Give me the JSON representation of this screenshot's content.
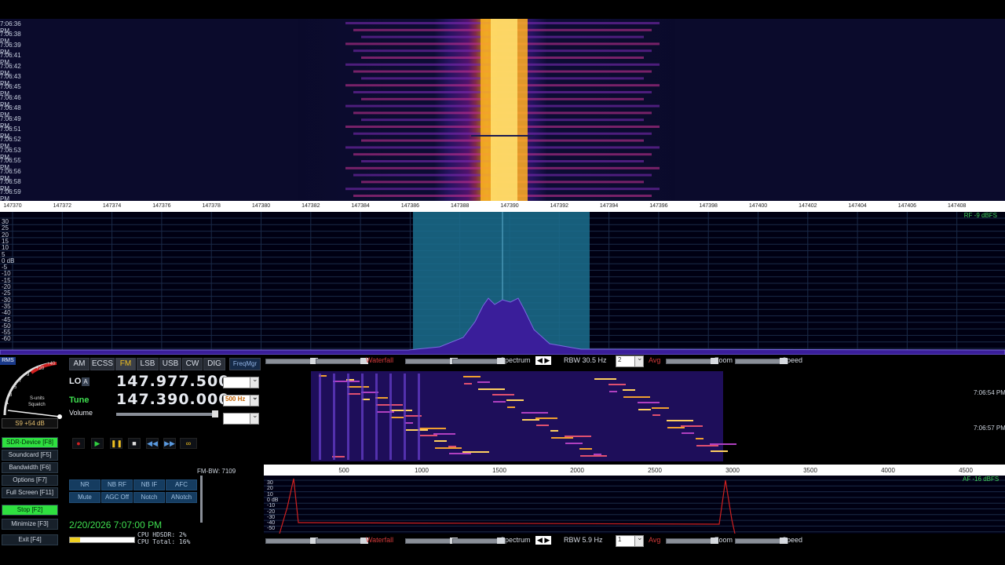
{
  "waterfall_top": {
    "time_labels": [
      "7:06:36 PM",
      "7:06:38 PM",
      "7:06:39 PM",
      "7:06:41 PM",
      "7:06:42 PM",
      "7:06:43 PM",
      "7:06:45 PM",
      "7:06:46 PM",
      "7:06:48 PM",
      "7:06:49 PM",
      "7:06:51 PM",
      "7:06:52 PM",
      "7:06:53 PM",
      "7:06:55 PM",
      "7:06:56 PM",
      "7:06:58 PM",
      "7:06:59 PM"
    ]
  },
  "freq_ruler": {
    "labels": [
      "147370",
      "147372",
      "147374",
      "147376",
      "147378",
      "147380",
      "147382",
      "147384",
      "147386",
      "147388",
      "147390",
      "147392",
      "147394",
      "147396",
      "147398",
      "147400",
      "147402",
      "147404",
      "147406",
      "147408"
    ]
  },
  "spectrum": {
    "db_labels": [
      "30",
      "25",
      "20",
      "15",
      "10",
      "5",
      "0 dB",
      "-5",
      "-10",
      "-15",
      "-20",
      "-25",
      "-30",
      "-35",
      "-40",
      "-45",
      "-50",
      "-55",
      "-60"
    ],
    "rf_level": "RF -9 dBFS"
  },
  "rf_toolbar": {
    "waterfall": "Waterfall",
    "spectrum": "Spectrum",
    "rbw": "RBW 30.5 Hz",
    "avg_value": "2",
    "avg": "Avg",
    "zoom": "Zoom",
    "speed": "Speed"
  },
  "smeter": {
    "rms": "RMS",
    "scale": [
      "+40",
      "+20",
      "9",
      "7",
      "5",
      "3",
      "1"
    ],
    "units": "S-units",
    "squelch": "Squelch",
    "reading": "S9 +54 dB"
  },
  "modes": [
    "AM",
    "ECSS",
    "FM",
    "LSB",
    "USB",
    "CW",
    "DIG"
  ],
  "freqmgr": "FreqMgr",
  "lo": {
    "label": "LO",
    "badge": "A",
    "value": "147.977.500"
  },
  "tune": {
    "label": "Tune",
    "value": "147.390.000",
    "step": "500 Hz"
  },
  "volume": {
    "label": "Volume"
  },
  "side_buttons": [
    {
      "label": "SDR-Device [F8]",
      "green": true
    },
    {
      "label": "Soundcard [F5]",
      "green": false
    },
    {
      "label": "Bandwidth [F6]",
      "green": false
    },
    {
      "label": "Options [F7]",
      "green": false
    },
    {
      "label": "Full Screen [F11]",
      "green": false
    },
    {
      "label": "Stop [F2]",
      "green": true
    },
    {
      "label": "Minimize [F3]",
      "green": false
    },
    {
      "label": "Exit [F4]",
      "green": false
    }
  ],
  "dsp_row1": [
    "NR",
    "NB RF",
    "NB IF",
    "AFC"
  ],
  "dsp_row2": [
    "Mute",
    "AGC Off",
    "Notch",
    "ANotch"
  ],
  "fm_bw": "FM-BW: 7109",
  "datetime": "2/20/2026 7:07:00 PM",
  "cpu": {
    "hdsdr": "CPU HDSDR: 2%",
    "total": "CPU Total: 16%"
  },
  "af_waterfall": {
    "time1": "7:06:54 PM",
    "time2": "7:06:57 PM"
  },
  "af_ruler": {
    "labels": [
      "500",
      "1000",
      "1500",
      "2000",
      "2500",
      "3000",
      "3500",
      "4000",
      "4500"
    ]
  },
  "af_spectrum": {
    "db_labels": [
      "30",
      "20",
      "10",
      "0 dB",
      "-10",
      "-20",
      "-30",
      "-40",
      "-50"
    ],
    "af_level": "AF -16 dBFS"
  },
  "af_toolbar": {
    "waterfall": "Waterfall",
    "spectrum": "Spectrum",
    "rbw": "RBW 5.9 Hz",
    "avg_value": "1",
    "avg": "Avg",
    "zoom": "Zoom",
    "speed": "Speed"
  },
  "colors": {
    "accent_green": "#2fe040",
    "mode_active": "#f0c020",
    "passband": "#1b6e8e",
    "spectrum_fill": "#3a1e9a"
  }
}
